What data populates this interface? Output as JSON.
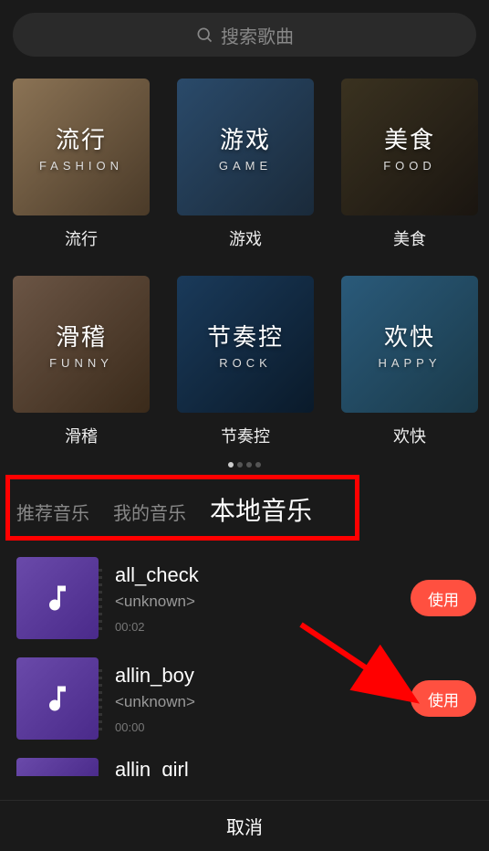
{
  "search": {
    "placeholder": "搜索歌曲"
  },
  "categories": [
    {
      "cn": "流行",
      "en": "FASHION",
      "label": "流行"
    },
    {
      "cn": "游戏",
      "en": "GAME",
      "label": "游戏"
    },
    {
      "cn": "美食",
      "en": "FOOD",
      "label": "美食"
    },
    {
      "cn": "滑稽",
      "en": "FUNNY",
      "label": "滑稽"
    },
    {
      "cn": "节奏控",
      "en": "ROCK",
      "label": "节奏控"
    },
    {
      "cn": "欢快",
      "en": "HAPPY",
      "label": "欢快"
    }
  ],
  "tabs": {
    "recommended": "推荐音乐",
    "mine": "我的音乐",
    "local": "本地音乐"
  },
  "songs": [
    {
      "title": "all_check",
      "artist": "<unknown>",
      "duration": "00:02"
    },
    {
      "title": "allin_boy",
      "artist": "<unknown>",
      "duration": "00:00"
    },
    {
      "title": "allin_girl",
      "artist": "",
      "duration": ""
    }
  ],
  "buttons": {
    "use": "使用",
    "cancel": "取消"
  },
  "colors": {
    "accent": "#ff5040",
    "highlight": "#ff0000"
  }
}
